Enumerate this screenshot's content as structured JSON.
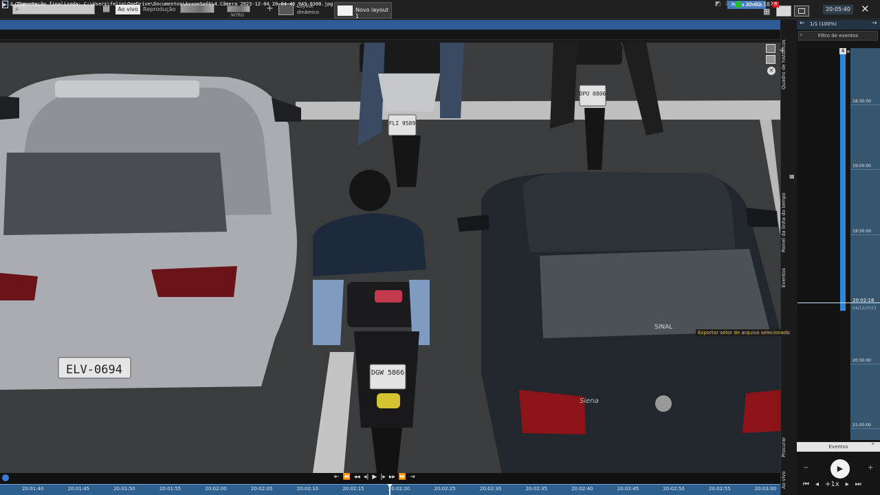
{
  "toolbar": {
    "search_placeholder": "",
    "live_label": "Ao vivo",
    "replay_label": "Reprodução",
    "thumb2_label": "NITRO",
    "dynamic_layout_label": "Layout dinâmico",
    "new_layout_label": "Novo layout 1",
    "clock": "20:05:40"
  },
  "export_bar": {
    "message": "Exportação finalizada: C:\\Users\\felip\\OneDrive\\Documentos\\AxxonSoft\\4.Câmera 2023-12-04 20-04-45_949-0300.jpg",
    "open_folder_label": "Pasta aberta",
    "close": "×"
  },
  "camera": {
    "name": "4.Câmera",
    "time": "20:02:18",
    "rec_badge": "R"
  },
  "video": {
    "plates": [
      "ELV-0694",
      "DGW 5866",
      "FLI 9589",
      "DPU 0806"
    ],
    "car_logo_text": "SINAL",
    "model_text": "Siena"
  },
  "side_tabs": {
    "history": "Quadro de históricos",
    "timeline": "Painel da linha do tempo",
    "events": "Eventos",
    "search": "Procurar",
    "live": "Ao vivo"
  },
  "tooltip": "Exportar setor de arquivo selecionado",
  "right_panel": {
    "page_counter": "1/1 (100%)",
    "filter_label": "Filtro de eventos",
    "bar_top_label": "4",
    "scale_ticks": [
      "18:30:00",
      "19:00:00",
      "19:30:00",
      "20:30:00",
      "21:00:00"
    ],
    "cursor_time": "20:02:18",
    "cursor_date": "04/12/2023",
    "events_tab": "Eventos",
    "speed": "+1x",
    "dot_colors": [
      "#d84a4a",
      "#e0c040",
      "#3cbf4a",
      "#3cbf4a",
      "#3a7bd5",
      "#d84ab8",
      "#8a8a8a",
      "#8a8a8a"
    ]
  },
  "timeline": {
    "labels": [
      "20:01:40",
      "20:01:45",
      "20:01:50",
      "20:01:55",
      "20:02:00",
      "20:02:05",
      "20:02:10",
      "20:02:15",
      "20:02:20",
      "20:02:25",
      "20:02:30",
      "20:02:35",
      "20:02:40",
      "20:02:45",
      "20:02:50",
      "20:02:55",
      "20:03:00"
    ]
  },
  "colors": {
    "accent": "#2f5b96",
    "timeline": "#2d5f8f",
    "recording": "#22bb33",
    "alarm": "#d02020"
  }
}
